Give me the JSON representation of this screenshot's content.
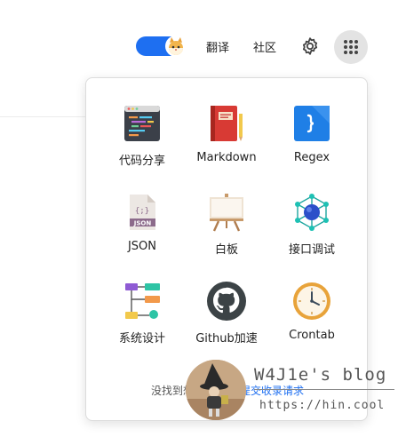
{
  "header": {
    "nav": [
      {
        "label": "翻译"
      },
      {
        "label": "社区"
      }
    ],
    "icons": {
      "theme_toggle": "theme-toggle-cat",
      "settings": "gear-icon",
      "apps": "grid-apps-icon"
    },
    "accent_color": "#1e6ff1"
  },
  "apps_panel": {
    "tiles": [
      {
        "label": "代码分享",
        "icon": "code-share-icon"
      },
      {
        "label": "Markdown",
        "icon": "markdown-book-icon"
      },
      {
        "label": "Regex",
        "icon": "regex-icon"
      },
      {
        "label": "JSON",
        "icon": "json-file-icon"
      },
      {
        "label": "白板",
        "icon": "whiteboard-icon"
      },
      {
        "label": "接口调试",
        "icon": "api-debug-icon"
      },
      {
        "label": "系统设计",
        "icon": "system-design-icon"
      },
      {
        "label": "Github加速",
        "icon": "github-icon"
      },
      {
        "label": "Crontab",
        "icon": "clock-icon"
      }
    ],
    "footer": {
      "text": "没找到想要",
      "link": "提交收录请求"
    }
  },
  "watermark": {
    "title": "W4J1e's blog",
    "url": "https://hin.cool"
  }
}
